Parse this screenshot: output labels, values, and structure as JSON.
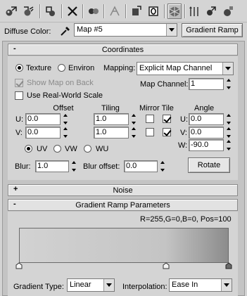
{
  "toolbar": {
    "icons": [
      "get-material-icon",
      "put-to-scene-icon",
      "assign-to-selection-icon",
      "reset-map-icon",
      "make-unique-icon",
      "put-to-library-icon",
      "material-id-channel-icon",
      "show-map-in-viewport-icon",
      "show-end-result-icon",
      "go-to-parent-icon",
      "go-forward-to-sibling-icon",
      "material-map-navigator-icon"
    ]
  },
  "diffuse": {
    "label": "Diffuse Color:",
    "map_value": "Map #5",
    "type_button": "Gradient Ramp"
  },
  "coordinates": {
    "header": "Coordinates",
    "toggle": "-",
    "texture_label": "Texture",
    "environ_label": "Environ",
    "mode_selected": "Texture",
    "mapping_label": "Mapping:",
    "mapping_value": "Explicit Map Channel",
    "show_map_on_back": "Show Map on Back",
    "show_map_on_back_checked": true,
    "map_channel_label": "Map Channel:",
    "map_channel_value": "1",
    "real_world_scale": "Use Real-World Scale",
    "real_world_scale_checked": false,
    "col_offset": "Offset",
    "col_tiling": "Tiling",
    "col_mirror_tile": "Mirror Tile",
    "col_angle": "Angle",
    "u_label": "U:",
    "v_label": "V:",
    "w_label": "W:",
    "offset_u": "0.0",
    "offset_v": "0.0",
    "tiling_u": "1.0",
    "tiling_v": "1.0",
    "mirror_u": false,
    "tile_u": true,
    "mirror_v": false,
    "tile_v": true,
    "angle_u": "0.0",
    "angle_v": "0.0",
    "angle_w": "-90.0",
    "uv_label": "UV",
    "vw_label": "VW",
    "wu_label": "WU",
    "plane_selected": "UV",
    "blur_label": "Blur:",
    "blur_value": "1.0",
    "blur_offset_label": "Blur offset:",
    "blur_offset_value": "0.0",
    "rotate_button": "Rotate"
  },
  "noise": {
    "header": "Noise",
    "toggle": "+"
  },
  "gradient_ramp": {
    "header": "Gradient Ramp Parameters",
    "toggle": "-",
    "status": "R=255,G=0,B=0, Pos=100",
    "colors": [
      "#d2d2d2",
      "#c4c4c4",
      "#8c8c8c"
    ],
    "gradient_type_label": "Gradient Type:",
    "gradient_type_value": "Linear",
    "interpolation_label": "Interpolation:",
    "interpolation_value": "Ease In"
  }
}
